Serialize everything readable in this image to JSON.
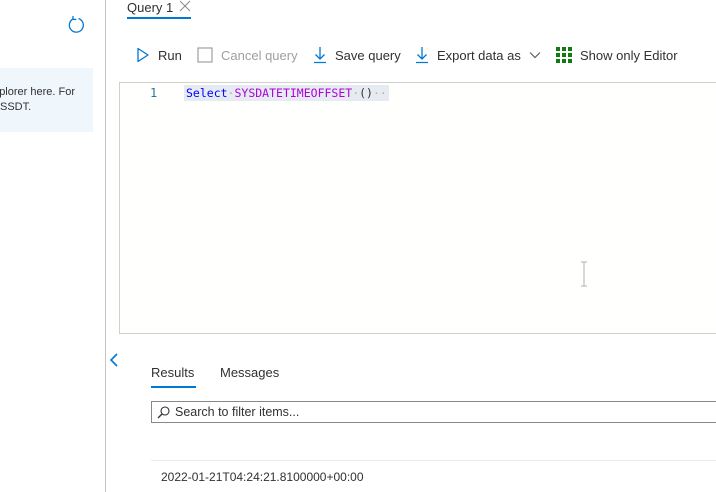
{
  "explorer": {
    "info_line1": "plorer here. For",
    "info_line2": "SSDT."
  },
  "query_tab": {
    "label": "Query 1"
  },
  "toolbar": {
    "run": "Run",
    "cancel_query": "Cancel query",
    "save_query": "Save query",
    "export_data_as": "Export data as",
    "show_only_editor": "Show only Editor"
  },
  "editor": {
    "line_number": "1",
    "tokens": {
      "keyword": "Select",
      "function": "SYSDATETIMEOFFSET",
      "args": "()"
    }
  },
  "results": {
    "tabs": [
      "Results",
      "Messages"
    ],
    "active_tab": "Results",
    "search_placeholder": "Search to filter items...",
    "rows": [
      "2022-01-21T04:24:21.8100000+00:00"
    ]
  },
  "colors": {
    "accent": "#0078d4",
    "keyword": "#0000ff",
    "function": "#af00db"
  }
}
